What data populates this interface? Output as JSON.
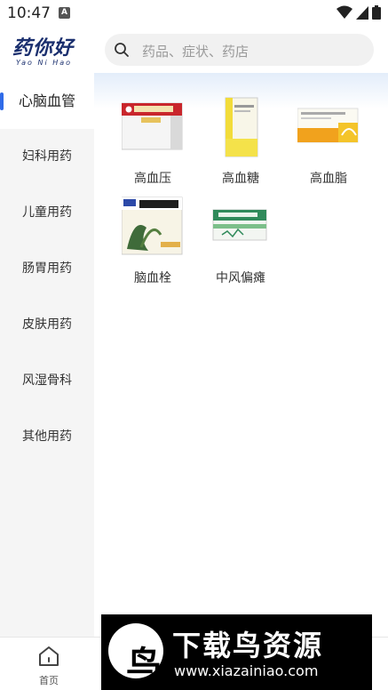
{
  "status_bar": {
    "time": "10:47",
    "badge": "A"
  },
  "header": {
    "logo_text": "药你好",
    "logo_sub": "Yao Ni Hao",
    "search_placeholder": "药品、症状、药店"
  },
  "sidebar": {
    "items": [
      {
        "label": "心脑血管",
        "active": true
      },
      {
        "label": "妇科用药",
        "active": false
      },
      {
        "label": "儿童用药",
        "active": false
      },
      {
        "label": "肠胃用药",
        "active": false
      },
      {
        "label": "皮肤用药",
        "active": false
      },
      {
        "label": "风湿骨科",
        "active": false
      },
      {
        "label": "其他用药",
        "active": false
      }
    ]
  },
  "products": [
    {
      "label": "高血压",
      "icon": "medicine-box-red-icon"
    },
    {
      "label": "高血糖",
      "icon": "medicine-box-yellow-icon"
    },
    {
      "label": "高血脂",
      "icon": "medicine-box-orange-icon"
    },
    {
      "label": "脑血栓",
      "icon": "medicine-box-herbal-icon"
    },
    {
      "label": "中风偏瘫",
      "icon": "medicine-box-green-icon"
    }
  ],
  "bottom_nav": {
    "home_label": "首页"
  },
  "watermark": {
    "title": "下载鸟资源",
    "url": "www.xiazainiao.com"
  },
  "colors": {
    "accent": "#2f6be8",
    "logo": "#1a2f6e"
  }
}
